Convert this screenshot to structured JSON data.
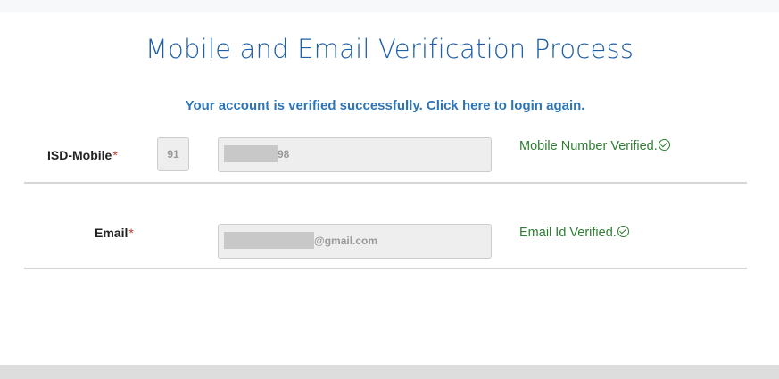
{
  "page": {
    "title": "Mobile and Email Verification Process",
    "success_message": "Your account is verified successfully. Click here to login again."
  },
  "mobile_row": {
    "label": "ISD-Mobile",
    "required_mark": "*",
    "isd_value": "91",
    "mobile_value_visible_suffix": "98",
    "status_text": "Mobile Number Verified.",
    "status_icon": "check-circle-icon"
  },
  "email_row": {
    "label": "Email",
    "required_mark": "*",
    "email_value_visible_suffix": "@gmail.com",
    "status_text": "Email Id Verified.",
    "status_icon": "check-circle-icon"
  },
  "colors": {
    "title": "#1f5fa6",
    "link": "#2e75b6",
    "verified": "#2e7d32",
    "required": "#c0392b"
  }
}
